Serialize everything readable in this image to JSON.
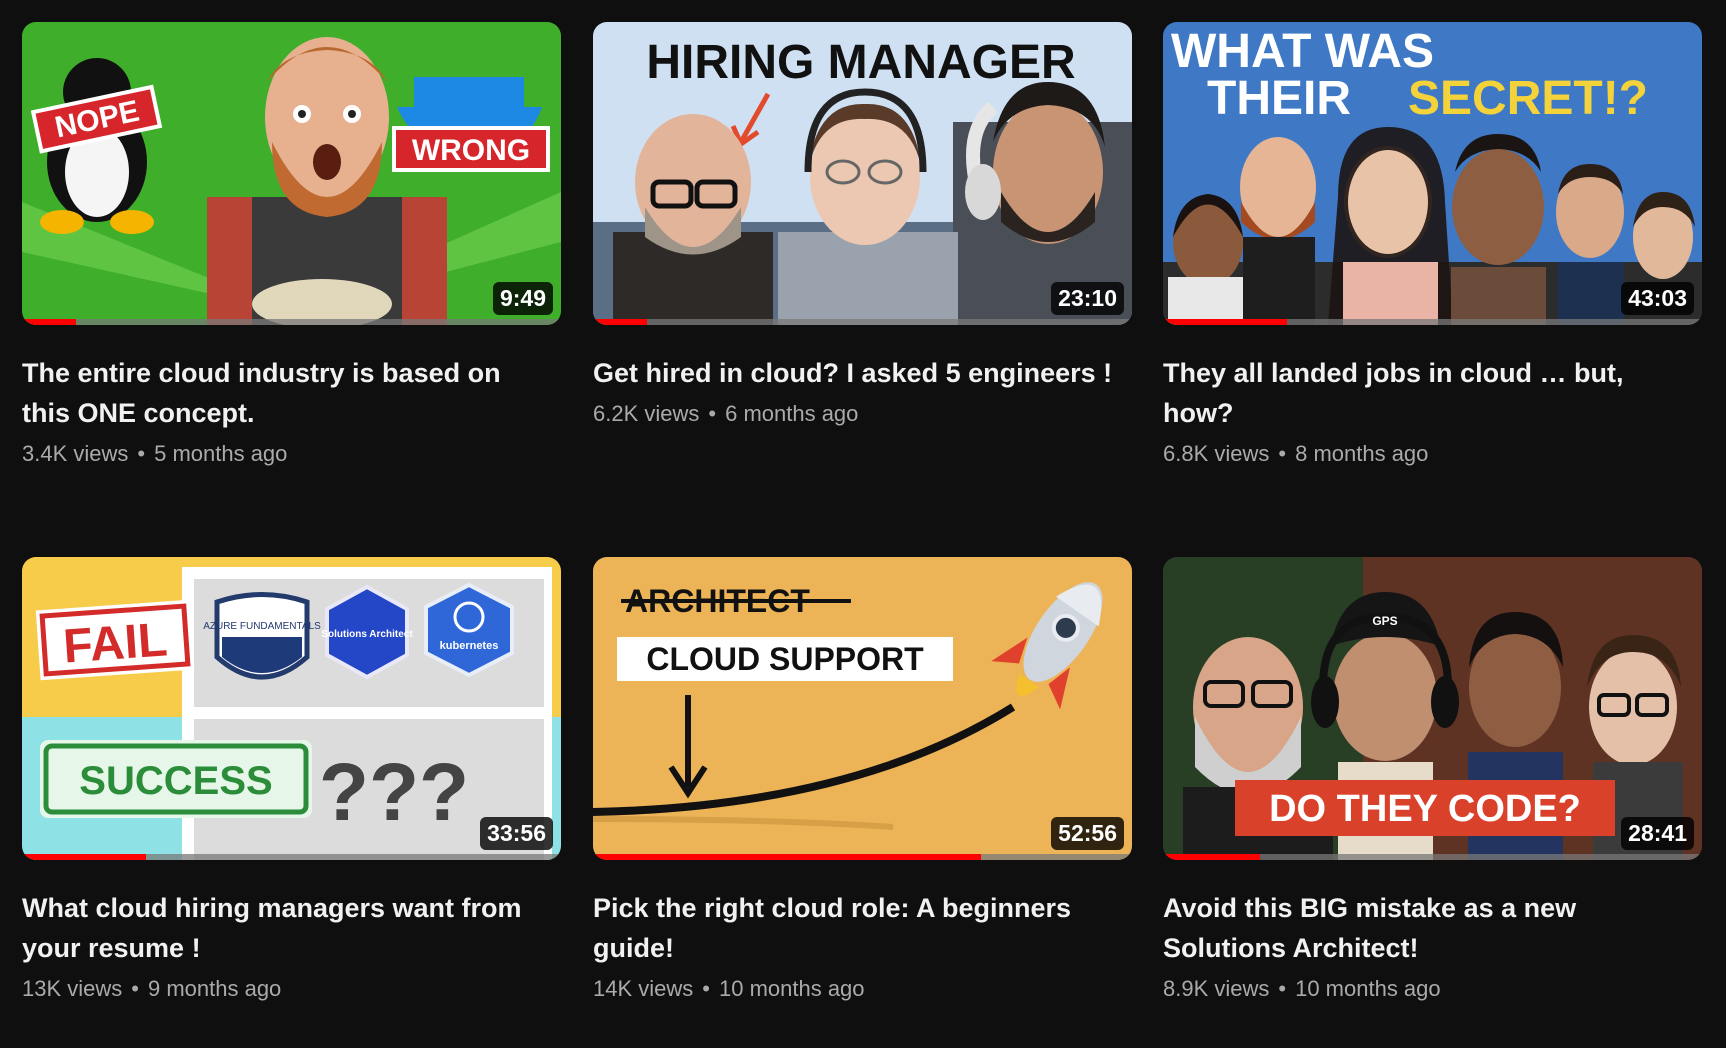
{
  "videos": [
    {
      "title": "The entire cloud industry is based on this ONE concept.",
      "views": "3.4K views",
      "age": "5 months ago",
      "duration": "9:49",
      "watched_fraction": 0.1,
      "thumb_text": {
        "a": "NOPE",
        "b": "WRONG"
      }
    },
    {
      "title": "Get hired in cloud? I asked 5 engineers !",
      "views": "6.2K views",
      "age": "6 months ago",
      "duration": "23:10",
      "watched_fraction": 0.1,
      "thumb_text": {
        "a": "HIRING MANAGER"
      }
    },
    {
      "title": "They all landed jobs in cloud … but, how?",
      "views": "6.8K views",
      "age": "8 months ago",
      "duration": "43:03",
      "watched_fraction": 0.23,
      "thumb_text": {
        "a": "WHAT WAS",
        "b": "THEIR",
        "c": "SECRET!?"
      }
    },
    {
      "title": "What cloud hiring managers want from your resume !",
      "views": "13K views",
      "age": "9 months ago",
      "duration": "33:56",
      "watched_fraction": 0.23,
      "thumb_text": {
        "a": "FAIL",
        "b": "SUCCESS",
        "c": "???",
        "d": "AZURE FUNDAMENTALS",
        "e": "Solutions Architect",
        "f": "kubernetes"
      }
    },
    {
      "title": "Pick the right cloud role: A beginners guide!",
      "views": "14K views",
      "age": "10 months ago",
      "duration": "52:56",
      "watched_fraction": 0.72,
      "thumb_text": {
        "a": "ARCHITECT",
        "b": "CLOUD SUPPORT"
      }
    },
    {
      "title": "Avoid this BIG mistake as a new Solutions Architect!",
      "views": "8.9K views",
      "age": "10 months ago",
      "duration": "28:41",
      "watched_fraction": 0.18,
      "thumb_text": {
        "a": "DO THEY CODE?"
      }
    }
  ]
}
